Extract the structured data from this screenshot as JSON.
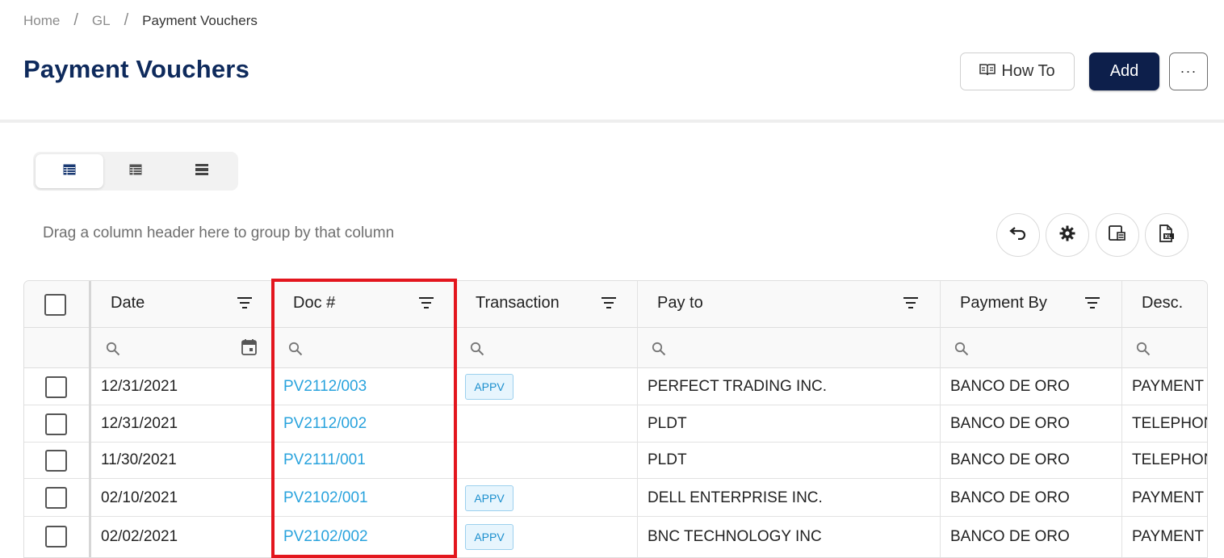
{
  "breadcrumb": {
    "home": "Home",
    "gl": "GL",
    "current": "Payment Vouchers"
  },
  "page": {
    "title": "Payment Vouchers"
  },
  "actions": {
    "howto_label": "How To",
    "add_label": "Add",
    "more_label": "···"
  },
  "view_toggle": {
    "icons": [
      "table-view-icon",
      "list-view-icon",
      "compact-view-icon"
    ],
    "active_index": 0
  },
  "grid": {
    "group_hint": "Drag a column header here to group by that column",
    "toolbar_icons": [
      "undo-icon",
      "gear-icon",
      "column-chooser-icon",
      "export-excel-icon"
    ],
    "columns": [
      "Date",
      "Doc #",
      "Transaction",
      "Pay to",
      "Payment By",
      "Desc."
    ],
    "rows": [
      {
        "date": "12/31/2021",
        "doc": "PV2112/003",
        "transaction": "APPV",
        "pay_to": "PERFECT TRADING INC.",
        "payment_by": "BANCO DE ORO",
        "desc": "PAYMENT I"
      },
      {
        "date": "12/31/2021",
        "doc": "PV2112/002",
        "transaction": "",
        "pay_to": "PLDT",
        "payment_by": "BANCO DE ORO",
        "desc": "TELEPHON"
      },
      {
        "date": "11/30/2021",
        "doc": "PV2111/001",
        "transaction": "",
        "pay_to": "PLDT",
        "payment_by": "BANCO DE ORO",
        "desc": "TELEPHON"
      },
      {
        "date": "02/10/2021",
        "doc": "PV2102/001",
        "transaction": "APPV",
        "pay_to": "DELL ENTERPRISE INC.",
        "payment_by": "BANCO DE ORO",
        "desc": "PAYMENT I"
      },
      {
        "date": "02/02/2021",
        "doc": "PV2102/002",
        "transaction": "APPV",
        "pay_to": "BNC TECHNOLOGY INC",
        "payment_by": "BANCO DE ORO",
        "desc": "PAYMENT I"
      }
    ]
  },
  "colors": {
    "title": "#0e2a5c",
    "add_button": "#0d1f4b",
    "link": "#29a3dd",
    "highlight": "#e3161e"
  }
}
